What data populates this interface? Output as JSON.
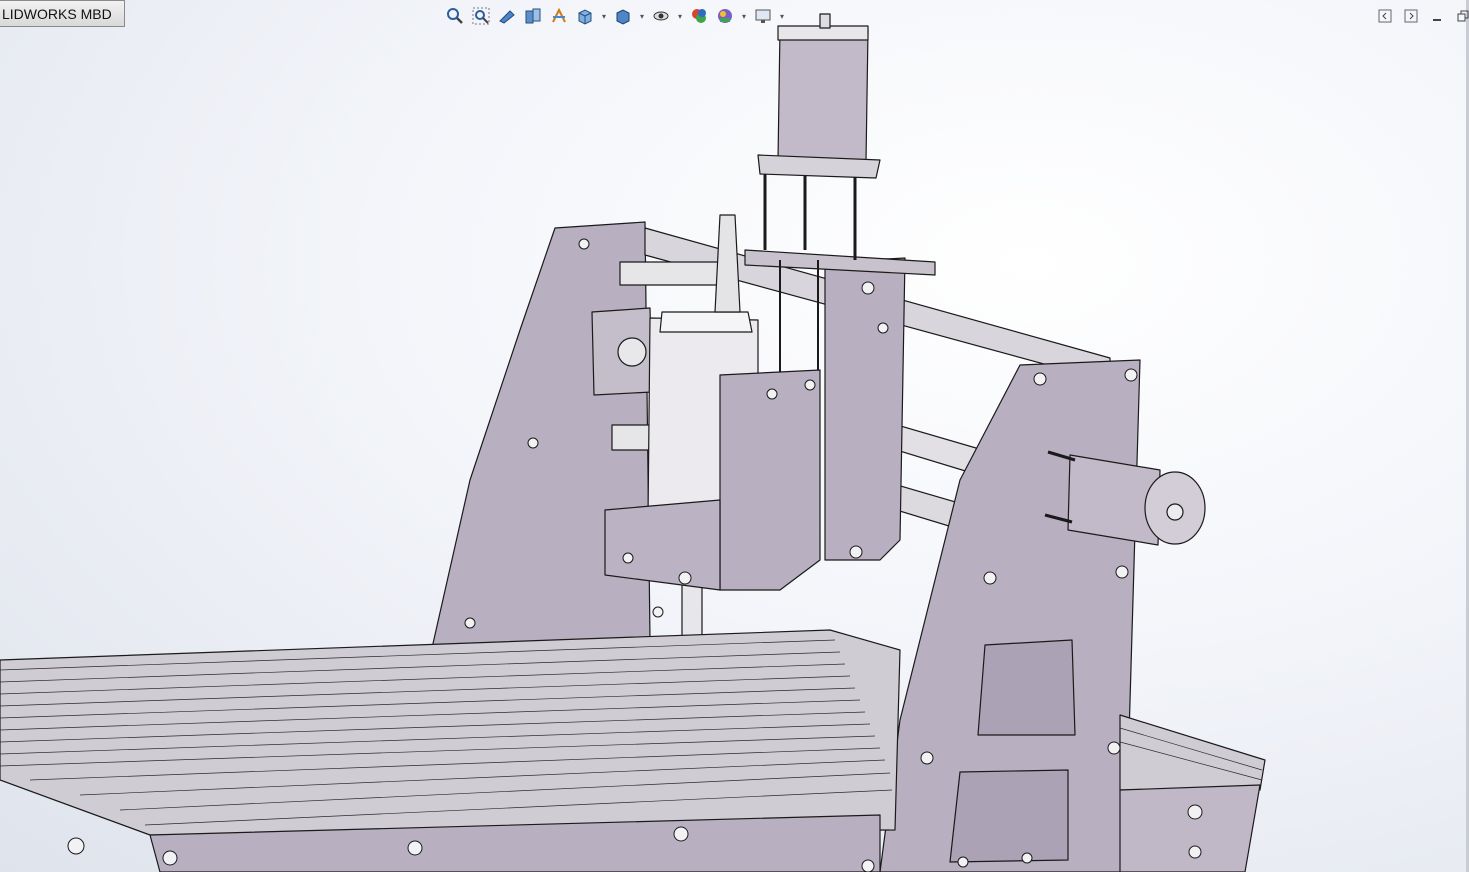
{
  "document_tab": {
    "label": "LIDWORKS MBD"
  },
  "heads_up_toolbar": {
    "tools": [
      {
        "icon": "zoom-to-fit-icon"
      },
      {
        "icon": "zoom-to-area-icon"
      },
      {
        "icon": "previous-view-icon"
      },
      {
        "icon": "section-view-icon"
      },
      {
        "icon": "dynamic-annotation-icon"
      },
      {
        "icon": "view-orientation-icon",
        "dropdown": true
      },
      {
        "icon": "display-style-icon",
        "dropdown": true
      },
      {
        "icon": "hide-show-items-icon",
        "dropdown": true
      },
      {
        "icon": "edit-appearance-icon"
      },
      {
        "icon": "apply-scene-icon",
        "dropdown": true
      },
      {
        "icon": "view-settings-icon",
        "dropdown": true
      }
    ]
  },
  "window_controls": [
    "tile-left-icon",
    "tile-right-icon",
    "minimize-icon",
    "restore-icon"
  ],
  "model": {
    "name": "cnc-router-assembly",
    "part_color": "#b8afc0",
    "edge_color": "#1a1a1a"
  }
}
